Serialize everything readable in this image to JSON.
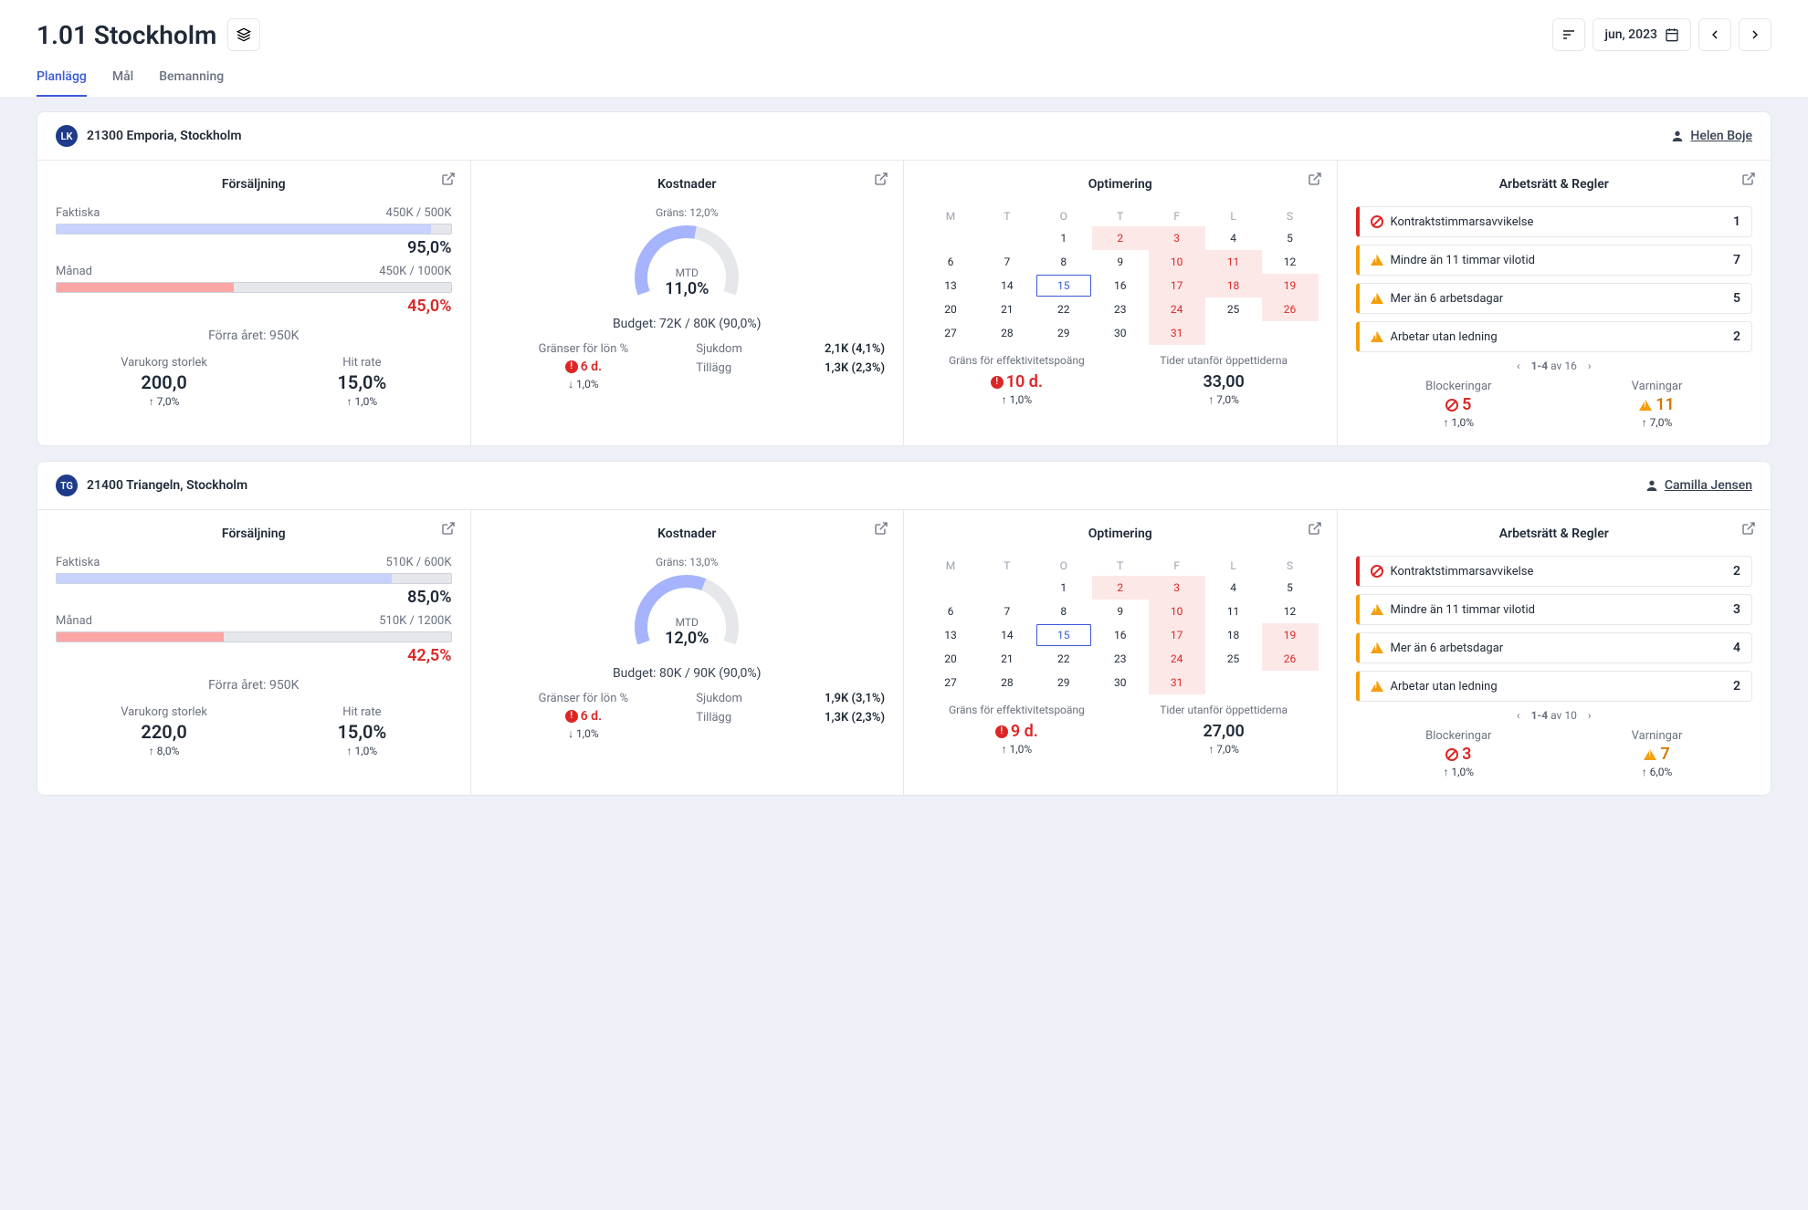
{
  "page_title": "1.01 Stockholm",
  "date_label": "jun, 2023",
  "tabs": [
    "Planlägg",
    "Mål",
    "Bemanning"
  ],
  "weekdays": [
    "M",
    "T",
    "O",
    "T",
    "F",
    "L",
    "S"
  ],
  "panel_titles": {
    "sales": "Försäljning",
    "costs": "Kostnader",
    "opt": "Optimering",
    "rules": "Arbetsrätt & Regler"
  },
  "labels": {
    "faktiska": "Faktiska",
    "manad": "Månad",
    "last_year": "Förra året: 950K",
    "cart": "Varukorg storlek",
    "hit": "Hit rate",
    "grans": "Gräns:",
    "budget_prefix": "Budget:",
    "mtd": "MTD",
    "salary_limit": "Gränser för lön %",
    "sick": "Sjukdom",
    "addon": "Tillägg",
    "eff": "Gräns för effektivitetspoäng",
    "outside": "Tider utanför öppettiderna",
    "blocks": "Blockeringar",
    "warnings": "Varningar",
    "pager_av": "av"
  },
  "rule_names": {
    "contract": "Kontraktstimmarsavvikelse",
    "rest": "Mindre än 11 timmar vilotid",
    "days": "Mer än 6 arbetsdagar",
    "nolead": "Arbetar utan ledning"
  },
  "locations": [
    {
      "avatar": "LK",
      "name": "21300 Emporia, Stockholm",
      "manager": "Helen Boje",
      "sales": {
        "faktiska": "450K / 500K",
        "faktiska_pct": "95,0%",
        "faktiska_fill": 95,
        "manad": "450K / 1000K",
        "manad_pct": "45,0%",
        "manad_fill": 45,
        "cart": "200,0",
        "cart_delta": "↑ 7,0%",
        "hit": "15,0%",
        "hit_delta": "↑ 1,0%"
      },
      "costs": {
        "limit": "12,0%",
        "mtd": "11,0%",
        "gauge_pct": 55,
        "budget": "72K / 80K (90,0%)",
        "salary_val": "6 d.",
        "salary_delta": "↓ 1,0%",
        "sick": "2,1K (4,1%)",
        "addon": "1,3K (2,3%)"
      },
      "calendar": [
        [
          null,
          null,
          null,
          null,
          null,
          null,
          null
        ],
        [
          null,
          null,
          1,
          {
            "d": 2,
            "r": 1
          },
          {
            "d": 3,
            "r": 1
          },
          4,
          5
        ],
        [
          6,
          7,
          8,
          9,
          {
            "d": 10,
            "r": 1
          },
          {
            "d": 11,
            "r": 1
          },
          12
        ],
        [
          13,
          14,
          {
            "d": 15,
            "t": 1
          },
          16,
          {
            "d": 17,
            "r": 1
          },
          {
            "d": 18,
            "r": 1
          },
          {
            "d": 19,
            "r": 1
          }
        ],
        [
          20,
          21,
          22,
          23,
          {
            "d": 24,
            "r": 1
          },
          25,
          {
            "d": 26,
            "r": 1
          }
        ],
        [
          27,
          28,
          29,
          30,
          {
            "d": 31,
            "r": 1
          },
          null,
          null
        ]
      ],
      "opt": {
        "eff_val": "10 d.",
        "eff_delta": "↑ 1,0%",
        "out_val": "33,00",
        "out_delta": "↑ 7,0%"
      },
      "rules": {
        "items": [
          {
            "t": "block",
            "n": "contract",
            "c": 1
          },
          {
            "t": "warn",
            "n": "rest",
            "c": 7
          },
          {
            "t": "warn",
            "n": "days",
            "c": 5
          },
          {
            "t": "warn",
            "n": "nolead",
            "c": 2
          }
        ],
        "pager": "1-4",
        "total": 16,
        "blocks": "5",
        "blocks_delta": "↑ 1,0%",
        "warnings": "11",
        "warn_delta": "↑ 7,0%"
      }
    },
    {
      "avatar": "TG",
      "name": "21400 Triangeln, Stockholm",
      "manager": "Camilla Jensen",
      "sales": {
        "faktiska": "510K / 600K",
        "faktiska_pct": "85,0%",
        "faktiska_fill": 85,
        "manad": "510K / 1200K",
        "manad_pct": "42,5%",
        "manad_fill": 42.5,
        "cart": "220,0",
        "cart_delta": "↑ 8,0%",
        "hit": "15,0%",
        "hit_delta": "↑ 1,0%"
      },
      "costs": {
        "limit": "13,0%",
        "mtd": "12,0%",
        "gauge_pct": 60,
        "budget": "80K / 90K (90,0%)",
        "salary_val": "6 d.",
        "salary_delta": "↓ 1,0%",
        "sick": "1,9K (3,1%)",
        "addon": "1,3K (2,3%)"
      },
      "calendar": [
        [
          null,
          null,
          null,
          null,
          null,
          null,
          null
        ],
        [
          null,
          null,
          1,
          {
            "d": 2,
            "r": 1
          },
          {
            "d": 3,
            "r": 1
          },
          4,
          5
        ],
        [
          6,
          7,
          8,
          9,
          {
            "d": 10,
            "r": 1
          },
          11,
          12
        ],
        [
          13,
          14,
          {
            "d": 15,
            "t": 1
          },
          16,
          {
            "d": 17,
            "r": 1
          },
          18,
          {
            "d": 19,
            "r": 1
          }
        ],
        [
          20,
          21,
          22,
          23,
          {
            "d": 24,
            "r": 1
          },
          25,
          {
            "d": 26,
            "r": 1
          }
        ],
        [
          27,
          28,
          29,
          30,
          {
            "d": 31,
            "r": 1
          },
          null,
          null
        ]
      ],
      "opt": {
        "eff_val": "9 d.",
        "eff_delta": "↑ 1,0%",
        "out_val": "27,00",
        "out_delta": "↑ 7,0%"
      },
      "rules": {
        "items": [
          {
            "t": "block",
            "n": "contract",
            "c": 2
          },
          {
            "t": "warn",
            "n": "rest",
            "c": 3
          },
          {
            "t": "warn",
            "n": "days",
            "c": 4
          },
          {
            "t": "warn",
            "n": "nolead",
            "c": 2
          }
        ],
        "pager": "1-4",
        "total": 10,
        "blocks": "3",
        "blocks_delta": "↑ 1,0%",
        "warnings": "7",
        "warn_delta": "↑ 6,0%"
      }
    }
  ],
  "chart_data": [
    {
      "type": "bar",
      "title": "Försäljning 21300",
      "categories": [
        "Faktiska",
        "Månad"
      ],
      "values": [
        95.0,
        45.0
      ],
      "ylim": [
        0,
        100
      ],
      "ylabel": "%"
    },
    {
      "type": "bar",
      "title": "Försäljning 21400",
      "categories": [
        "Faktiska",
        "Månad"
      ],
      "values": [
        85.0,
        42.5
      ],
      "ylim": [
        0,
        100
      ],
      "ylabel": "%"
    }
  ]
}
